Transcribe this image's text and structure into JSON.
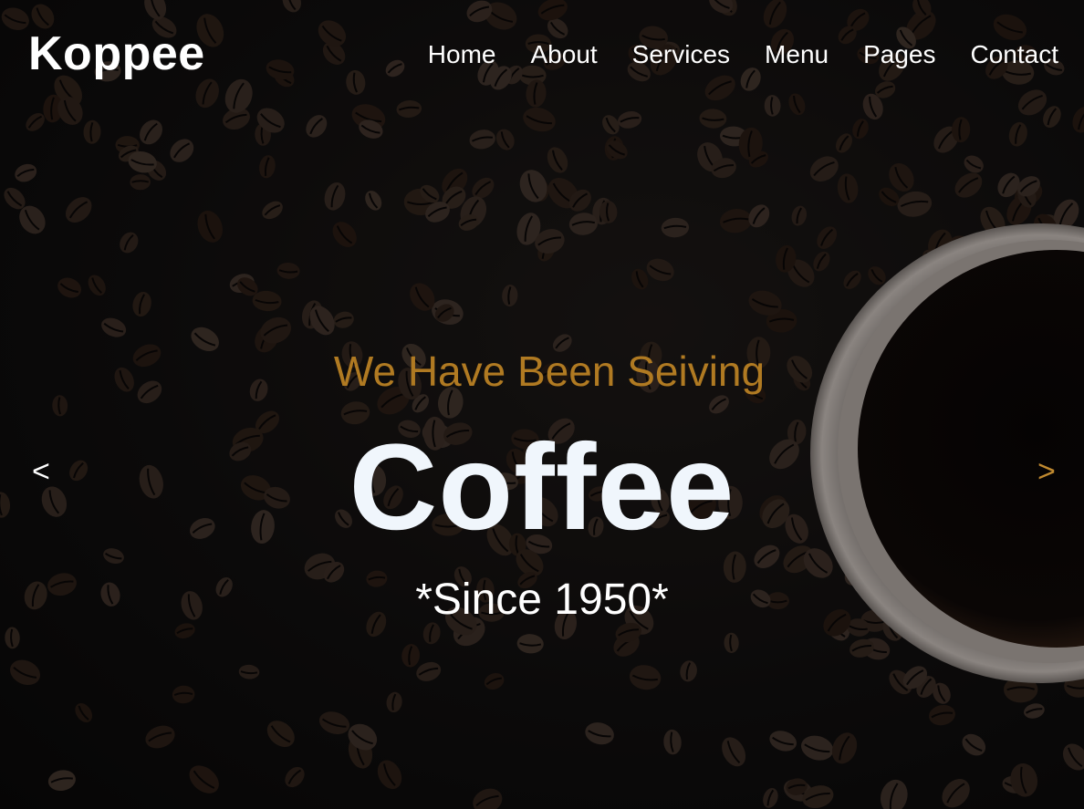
{
  "brand": {
    "name": "Koppee"
  },
  "nav": {
    "items": [
      {
        "label": "Home"
      },
      {
        "label": "About"
      },
      {
        "label": "Services"
      },
      {
        "label": "Menu"
      },
      {
        "label": "Pages"
      },
      {
        "label": "Contact"
      }
    ]
  },
  "hero": {
    "subtitle": "We Have Been Seiving",
    "headline": "Coffee",
    "since": "*Since 1950*",
    "prev_label": "<",
    "next_label": ">",
    "background_image": "coffee-beans-and-cup-photo"
  },
  "colors": {
    "accent": "#b07a22",
    "headline": "#f0f6fc",
    "nav_text": "#ffffff",
    "background": "#0d0c0c"
  }
}
